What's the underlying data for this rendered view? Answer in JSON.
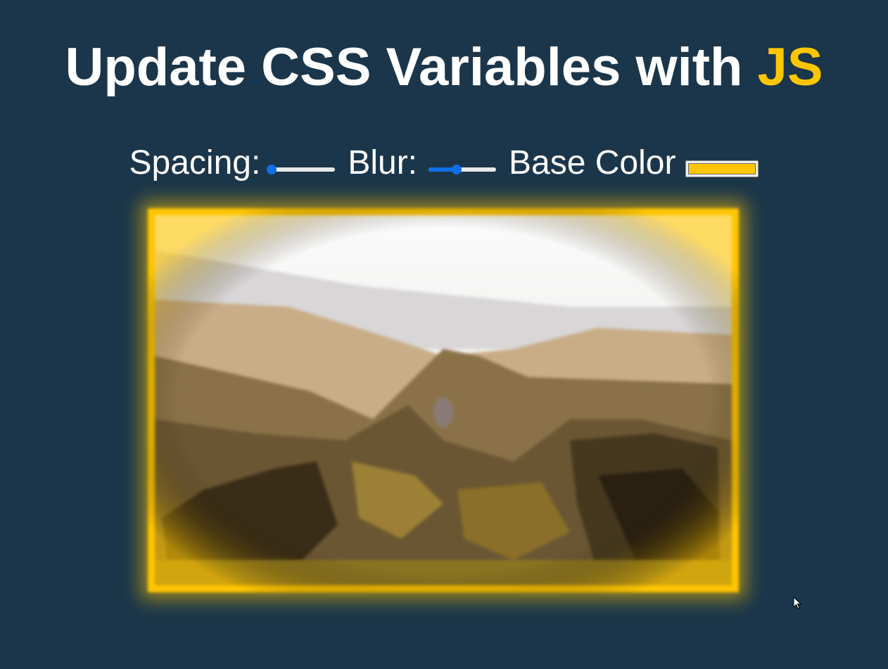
{
  "header": {
    "title_prefix": "Update CSS Variables with ",
    "title_highlight": "JS"
  },
  "controls": {
    "spacing_label": "Spacing:",
    "spacing_value_fraction": 0.0,
    "blur_label": "Blur:",
    "blur_value_fraction": 0.42,
    "base_color_label": "Base Color",
    "base_color_value": "#ffc600"
  },
  "image": {
    "alt": "landscape-photo",
    "border_color": "#ffc600"
  },
  "colors": {
    "background": "#1b364a",
    "accent": "#ffc600",
    "slider_active": "#0f6ee8",
    "text": "#ffffff"
  },
  "icons": {
    "cursor": "mouse-pointer-icon"
  }
}
